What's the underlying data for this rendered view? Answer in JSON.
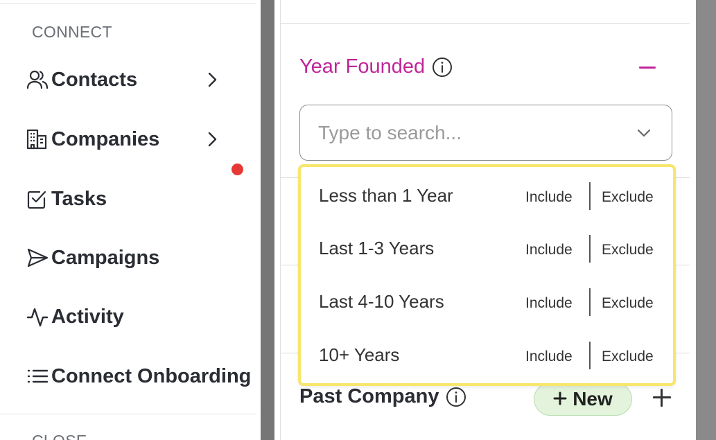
{
  "sidebar": {
    "section_connect": "CONNECT",
    "section_close": "CLOSE",
    "items": [
      {
        "label": "Contacts",
        "icon": "contacts-icon",
        "has_chevron": true
      },
      {
        "label": "Companies",
        "icon": "companies-icon",
        "has_chevron": true
      },
      {
        "label": "Tasks",
        "icon": "tasks-icon",
        "has_chevron": false
      },
      {
        "label": "Campaigns",
        "icon": "campaigns-icon",
        "has_chevron": false
      },
      {
        "label": "Activity",
        "icon": "activity-icon",
        "has_chevron": false
      },
      {
        "label": "Connect Onboarding",
        "icon": "list-icon",
        "has_chevron": false
      }
    ],
    "notification_dot_color": "#e53935"
  },
  "filter": {
    "year_founded": {
      "title": "Year Founded",
      "title_color": "#c0259a",
      "search_placeholder": "Type to search...",
      "options": [
        {
          "label": "Less than 1 Year",
          "include": "Include",
          "exclude": "Exclude"
        },
        {
          "label": "Last 1-3 Years",
          "include": "Include",
          "exclude": "Exclude"
        },
        {
          "label": "Last 4-10 Years",
          "include": "Include",
          "exclude": "Exclude"
        },
        {
          "label": "10+ Years",
          "include": "Include",
          "exclude": "Exclude"
        }
      ],
      "dropdown_highlight_color": "#f7e66b"
    },
    "past_company": {
      "title": "Past Company",
      "new_button_label": "New",
      "new_button_color": "#e3f3dc"
    }
  }
}
